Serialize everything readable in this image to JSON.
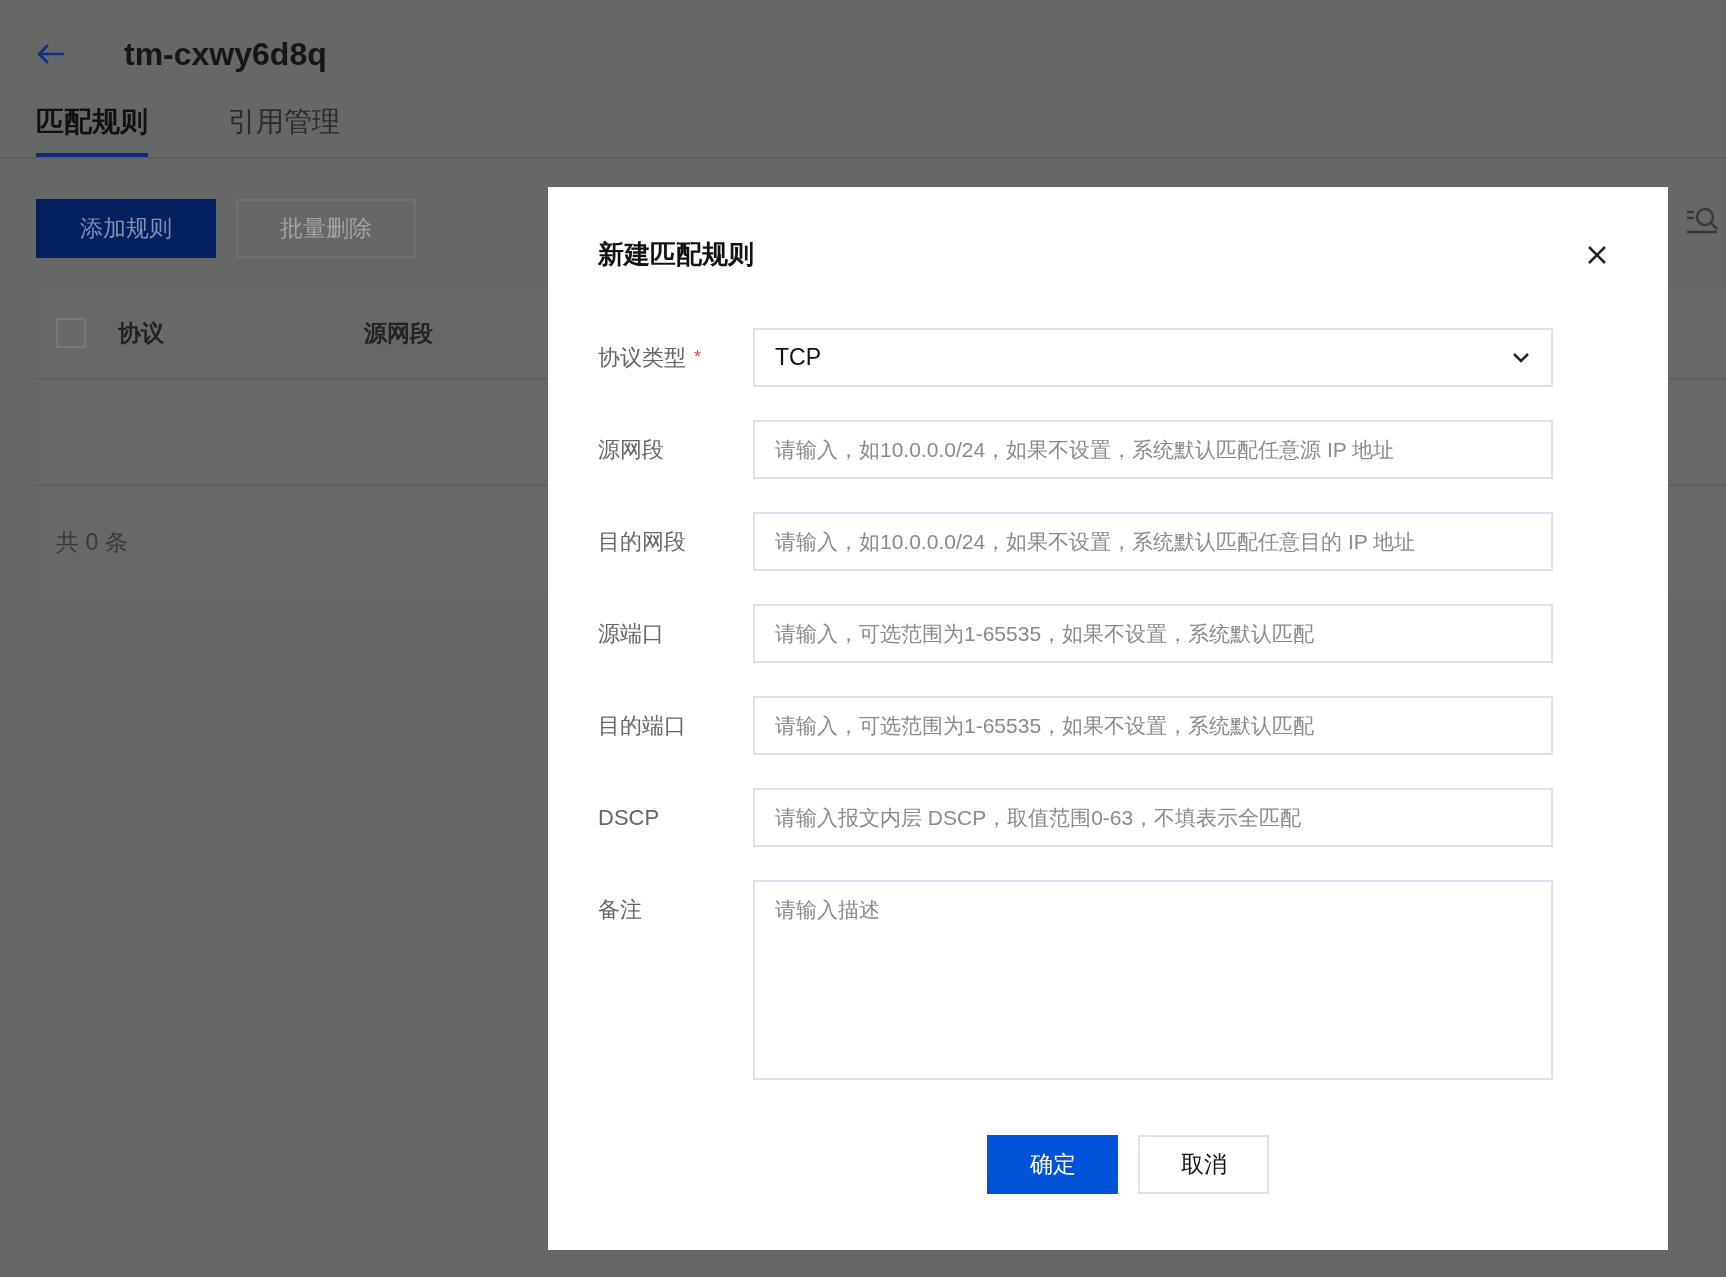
{
  "page": {
    "title": "tm-cxwy6d8q"
  },
  "tabs": [
    {
      "label": "匹配规则",
      "selected": true
    },
    {
      "label": "引用管理",
      "selected": false
    }
  ],
  "toolbar": {
    "buttons": [
      {
        "label": "添加规则",
        "kind": "primary"
      },
      {
        "label": "批量删除",
        "kind": "disabled"
      }
    ]
  },
  "table": {
    "select_all_checked": false,
    "columns": [
      "协议",
      "源网段"
    ],
    "footer": "共 0 条"
  },
  "dialog": {
    "title": "新建匹配规则",
    "required_mark": "*",
    "fields": [
      {
        "label": "协议类型",
        "required": true,
        "kind": "select",
        "value": "TCP"
      },
      {
        "label": "源网段",
        "required": false,
        "kind": "input",
        "placeholder": "请输入，如10.0.0.0/24，如果不设置，系统默认匹配任意源 IP 地址"
      },
      {
        "label": "目的网段",
        "required": false,
        "kind": "input",
        "placeholder": "请输入，如10.0.0.0/24，如果不设置，系统默认匹配任意目的 IP 地址"
      },
      {
        "label": "源端口",
        "required": false,
        "kind": "input",
        "placeholder": "请输入，可选范围为1-65535，如果不设置，系统默认匹配"
      },
      {
        "label": "目的端口",
        "required": false,
        "kind": "input",
        "placeholder": "请输入，可选范围为1-65535，如果不设置，系统默认匹配"
      },
      {
        "label": "DSCP",
        "required": false,
        "kind": "input",
        "placeholder": "请输入报文内层 DSCP，取值范围0-63，不填表示全匹配"
      },
      {
        "label": "备注",
        "required": false,
        "kind": "textarea",
        "placeholder": "请输入描述"
      }
    ],
    "buttons": [
      {
        "label": "确定",
        "kind": "primary"
      },
      {
        "label": "取消",
        "kind": "default"
      }
    ]
  }
}
